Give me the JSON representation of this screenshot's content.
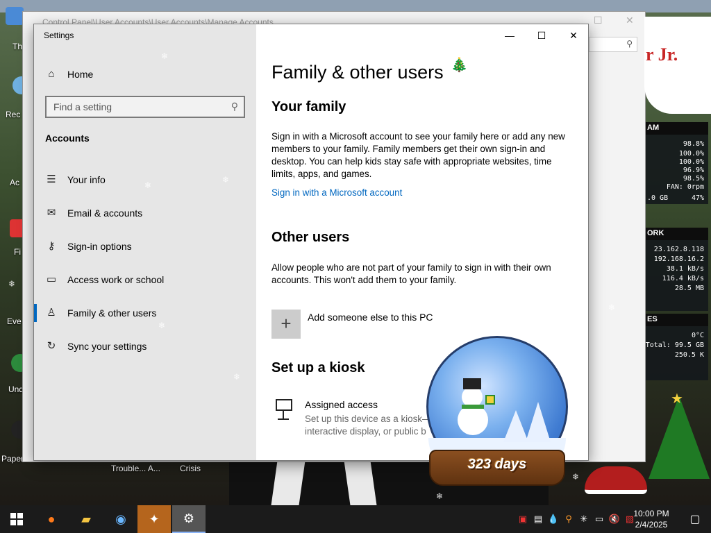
{
  "desktop": {
    "icons_left": [
      "Th",
      "Rec",
      "Ac",
      "Fi",
      "Eve",
      "Und",
      "Papers"
    ],
    "taskbar_apps_labels": [
      "Trouble... A...",
      "Crisis"
    ],
    "bg_window_title": "Control Panel\\User Accounts\\User Accounts\\Manage Accounts",
    "speech_text": "r Jr.",
    "globe_days": "323 days"
  },
  "meters": {
    "ram": {
      "header": "AM",
      "lines": [
        "98.8%",
        "100.0%",
        "100.0%",
        "96.9%",
        "98.5%",
        "FAN: 0rpm"
      ],
      "footer_left": ".0 GB",
      "footer_right": "47%"
    },
    "network": {
      "header": "ORK",
      "lines": [
        "23.162.8.118",
        "192.168.16.2",
        "38.1 kB/s",
        "116.4 kB/s",
        "28.5 MB"
      ]
    },
    "disk": {
      "header": "ES",
      "lines": [
        "0°C",
        "Total: 99.5 GB",
        "250.5 K"
      ]
    }
  },
  "settings": {
    "window_title": "Settings",
    "controls": {
      "minimize": "—",
      "maximize": "☐",
      "close": "✕"
    },
    "sidebar": {
      "home_label": "Home",
      "search_placeholder": "Find a setting",
      "section_title": "Accounts",
      "items": [
        {
          "label": "Your info",
          "icon": "person-card-icon"
        },
        {
          "label": "Email & accounts",
          "icon": "mail-icon"
        },
        {
          "label": "Sign-in options",
          "icon": "key-icon"
        },
        {
          "label": "Access work or school",
          "icon": "briefcase-icon"
        },
        {
          "label": "Family & other users",
          "icon": "person-add-icon",
          "active": true
        },
        {
          "label": "Sync your settings",
          "icon": "sync-icon"
        }
      ]
    },
    "content": {
      "title": "Family & other users",
      "family": {
        "heading": "Your family",
        "text": "Sign in with a Microsoft account to see your family here or add any new members to your family. Family members get their own sign-in and desktop. You can help kids stay safe with appropriate websites, time limits, apps, and games.",
        "link": "Sign in with a Microsoft account"
      },
      "other_users": {
        "heading": "Other users",
        "text": "Allow people who are not part of your family to sign in with their own accounts. This won't add them to your family.",
        "add_label": "Add someone else to this PC"
      },
      "kiosk": {
        "heading": "Set up a kiosk",
        "title": "Assigned access",
        "desc": "Set up this device as a kiosk—interactive display, or public b"
      }
    }
  },
  "taskbar": {
    "time": "10:00 PM",
    "date": "2/4/2025"
  }
}
